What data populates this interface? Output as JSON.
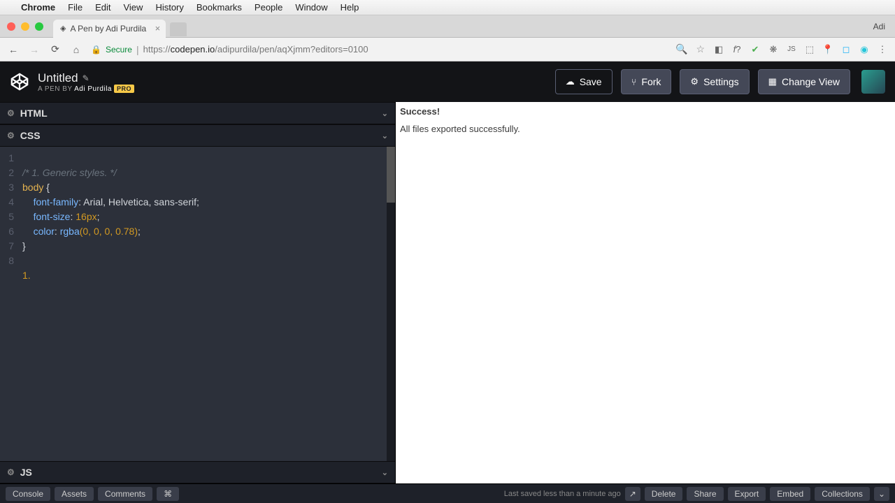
{
  "mac_menu": [
    "Chrome",
    "File",
    "Edit",
    "View",
    "History",
    "Bookmarks",
    "People",
    "Window",
    "Help"
  ],
  "browser": {
    "tab_title": "A Pen by Adi Purdila",
    "profile": "Adi",
    "secure": "Secure",
    "url_prefix": "https://",
    "url_host": "codepen.io",
    "url_path": "/adipurdila/pen/aqXjmm?editors=0100"
  },
  "codepen": {
    "title": "Untitled",
    "byline_prefix": "A PEN BY ",
    "author": "Adi Purdila",
    "pro": "PRO",
    "buttons": {
      "save": "Save",
      "fork": "Fork",
      "settings": "Settings",
      "change_view": "Change View"
    }
  },
  "panels": {
    "html": "HTML",
    "css": "CSS",
    "js": "JS"
  },
  "code": {
    "lines": [
      "1",
      "2",
      "3",
      "4",
      "5",
      "6",
      "7",
      "8"
    ],
    "l1": "/* 1. Generic styles. */",
    "l2_sel": "body",
    "l2_r": " {",
    "l3_p": "font-family",
    "l3_v": ": Arial, Helvetica, sans-serif;",
    "l4_p": "font-size",
    "l4_v": ": ",
    "l4_n": "16px",
    "l4_e": ";",
    "l5_p": "color",
    "l5_v": ": ",
    "l5_f": "rgba",
    "l5_args": "(0, 0, 0, 0.78)",
    "l5_e": ";",
    "l6": "}",
    "l8": "1."
  },
  "preview": {
    "heading": "Success!",
    "body": "All files exported successfully."
  },
  "footer": {
    "left": [
      "Console",
      "Assets",
      "Comments",
      "⌘"
    ],
    "status": "Last saved less than a minute ago",
    "right": [
      "Delete",
      "Share",
      "Export",
      "Embed",
      "Collections"
    ]
  }
}
